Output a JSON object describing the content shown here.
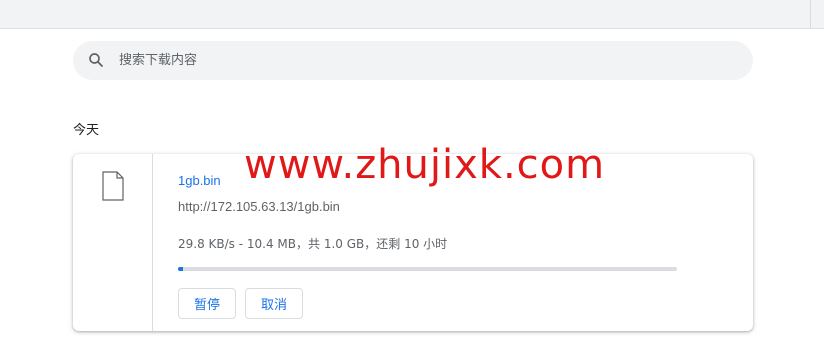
{
  "search": {
    "placeholder": "搜索下载内容",
    "icon": "search-icon"
  },
  "section": {
    "title": "今天"
  },
  "download": {
    "file_name": "1gb.bin",
    "url": "http://172.105.63.13/1gb.bin",
    "status": "29.8 KB/s - 10.4 MB，共 1.0 GB，还剩 10 小时",
    "progress_fraction": 0.0104,
    "icon": "file-icon",
    "pause_label": "暂停",
    "cancel_label": "取消"
  },
  "watermark": {
    "text": "www.zhujixk.com"
  },
  "colors": {
    "accent": "#1a73e8",
    "watermark": "#e01818"
  }
}
